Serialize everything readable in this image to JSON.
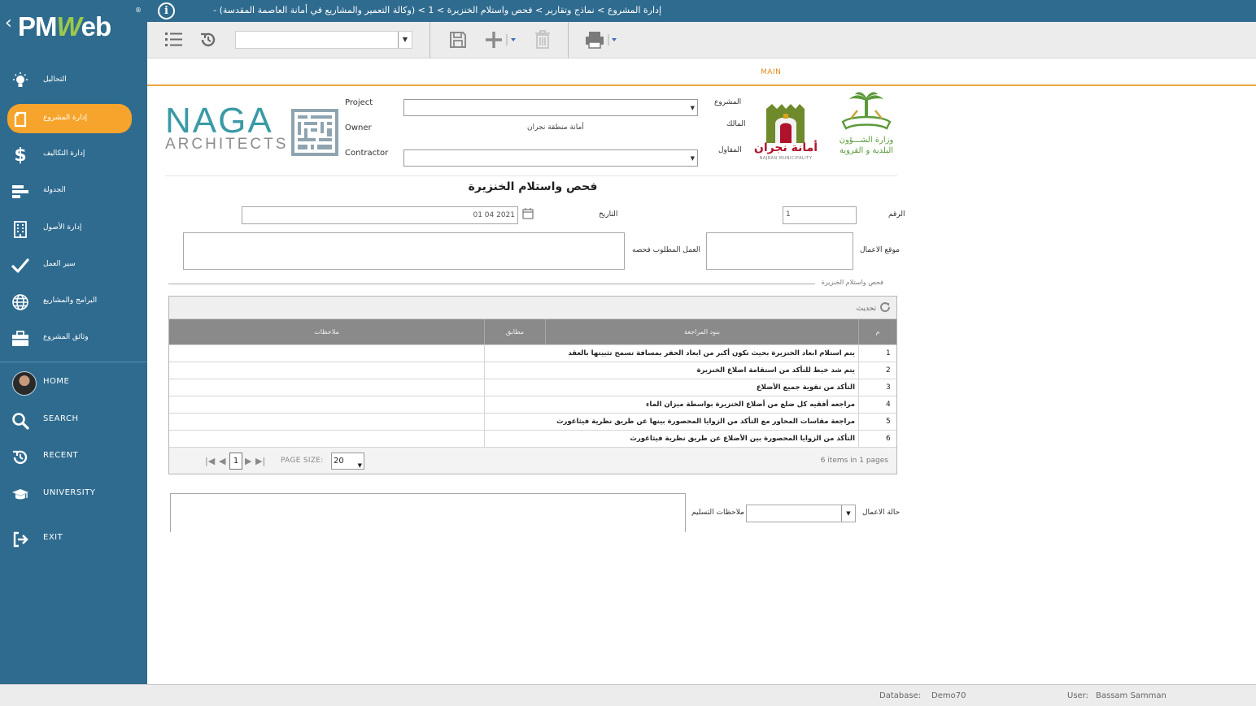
{
  "app": {
    "logo_text": "PMWeb",
    "reg_mark": "®"
  },
  "breadcrumb": "إدارة المشروع > نماذج وتقارير > فحص واستلام الخنزيرة > 1 > (وكالة التعمير والمشاريع في أمانة العاصمة المقدسة) -",
  "sidebar": {
    "items": [
      {
        "id": "analysis",
        "label": "التحاليل",
        "icon": "lightbulb-icon"
      },
      {
        "id": "project-management",
        "label": "إدارة المشروع",
        "icon": "document-icon",
        "active": true
      },
      {
        "id": "cost-management",
        "label": "إدارة التكاليف",
        "icon": "dollar-icon"
      },
      {
        "id": "scheduling",
        "label": "الجدولة",
        "icon": "gantt-icon"
      },
      {
        "id": "asset-management",
        "label": "إدارة الأصول",
        "icon": "building-icon"
      },
      {
        "id": "workflow",
        "label": "سير العمل",
        "icon": "checkmark-icon"
      },
      {
        "id": "programs",
        "label": "البرامج والمشاريع",
        "icon": "globe-icon"
      },
      {
        "id": "project-documents",
        "label": "وثائق المشروع",
        "icon": "briefcase-icon"
      }
    ],
    "bottom_items": [
      {
        "id": "home",
        "label": "HOME",
        "icon": "avatar"
      },
      {
        "id": "search",
        "label": "SEARCH",
        "icon": "search-icon"
      },
      {
        "id": "recent",
        "label": "RECENT",
        "icon": "history-icon"
      },
      {
        "id": "university",
        "label": "UNIVERSITY",
        "icon": "graduation-cap-icon"
      },
      {
        "id": "exit",
        "label": "EXIT",
        "icon": "exit-icon"
      }
    ]
  },
  "toolbar": {
    "combo_value": ""
  },
  "tabs": {
    "main": "MAIN"
  },
  "header": {
    "company_logo": {
      "name": "NAGA",
      "sub": "ARCHITECTS"
    },
    "project_label": "Project",
    "owner_label": "Owner",
    "contractor_label": "Contractor",
    "project_label_ar": "المشروع",
    "owner_label_ar": "المالك",
    "contractor_label_ar": "المقاول",
    "owner_value": "أمانة منطقة نجران",
    "najran_logo_text": "أمانة نجران",
    "najran_logo_sub": "NAJRAN MUNICIPALITY",
    "ministry_logo_line1": "وزارة الشـــؤون",
    "ministry_logo_line2": "البلدية و القروية"
  },
  "form": {
    "title": "فحص واستلام الخنزيرة",
    "date_label": "التاريخ",
    "date_value": "01 04 2021",
    "no_label": "الرقم",
    "no_value": "1",
    "work_request_label": "العمل المطلوب فحصه",
    "work_location_label": "موقع الاعمال",
    "section_title": "فحص واستلام الخنزيرة"
  },
  "grid": {
    "refresh_label": "تحديث",
    "columns": {
      "num": "م",
      "item": "بنود المراجعة",
      "match": "مطابق",
      "notes": "ملاحظات"
    },
    "rows": [
      {
        "num": "1",
        "item": "يتم استلام ابعاد الخنزيرة بحيث تكون أكبر من ابعاد الحفر بمسافة تسمح تثبيتها بالعقد"
      },
      {
        "num": "2",
        "item": "يتم شد خيط للتأكد من استقامة اضلاع الخنزيرة"
      },
      {
        "num": "3",
        "item": "التأكد من تقوية جميع الأضلاع"
      },
      {
        "num": "4",
        "item": "مراجعه أفقيه كل ضلع من أضلاع الخنزيرة بواسطة ميزان الماء"
      },
      {
        "num": "5",
        "item": "مراجعة مقاسات المحاور مع التأكد من الزوايا المحصورة بينها عن طريق نظرية فيثاغورث"
      },
      {
        "num": "6",
        "item": "التأكد من الزوايا المحصورة بين الأضلاع عن طريق نظرية فيثاغورث"
      }
    ],
    "pager": {
      "current_page": "1",
      "page_size_label": "PAGE SIZE:",
      "page_size": "20",
      "summary": "6 items in 1 pages"
    }
  },
  "bottom": {
    "handover_notes_label": "ملاحظات التسليم",
    "work_status_label": "حالة الاعمال"
  },
  "status": {
    "database_label": "Database:",
    "database": "Demo70",
    "user_label": "User:",
    "user": "Bassam Samman"
  }
}
